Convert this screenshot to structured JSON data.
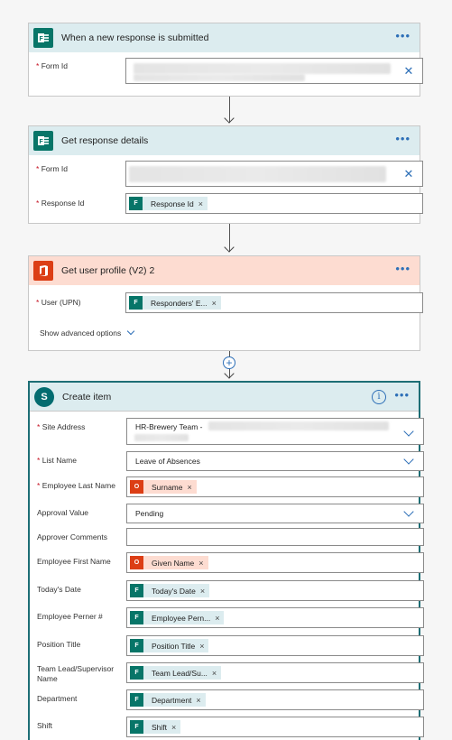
{
  "trigger": {
    "title": "When a new response is submitted",
    "form_id_label": "Form Id",
    "required_mark": "*",
    "more": "•••",
    "clear": "✕"
  },
  "details": {
    "title": "Get response details",
    "form_id_label": "Form Id",
    "response_id_label": "Response Id",
    "response_id_token": "Response Id",
    "more": "•••"
  },
  "profile": {
    "title": "Get user profile (V2) 2",
    "user_label": "User (UPN)",
    "user_token": "Responders' E...",
    "advanced": "Show advanced options",
    "more": "•••"
  },
  "create": {
    "title": "Create item",
    "more": "•••",
    "info": "i",
    "fields": [
      {
        "label": "Site Address",
        "required": true,
        "value": "HR-Brewery Team -"
      },
      {
        "label": "List Name",
        "required": true,
        "value": "Leave of Absences"
      },
      {
        "label": "Employee Last Name",
        "required": true,
        "token": "Surname"
      },
      {
        "label": "Approval Value",
        "required": false,
        "value": "Pending"
      },
      {
        "label": "Approver Comments",
        "required": false
      },
      {
        "label": "Employee First Name",
        "required": false,
        "token": "Given Name"
      },
      {
        "label": "Today's Date",
        "required": false,
        "token": "Today's Date"
      },
      {
        "label": "Employee Perner #",
        "required": false,
        "token": "Employee Pern..."
      },
      {
        "label": "Position Title",
        "required": false,
        "token": "Position Title"
      },
      {
        "label": "Team Lead/Supervisor Name",
        "required": false,
        "token": "Team Lead/Su..."
      },
      {
        "label": "Department",
        "required": false,
        "token": "Department"
      },
      {
        "label": "Shift",
        "required": false,
        "token": "Shift"
      }
    ]
  },
  "token_remove": "×",
  "colors": {
    "forms": "#077568",
    "office": "#dc3e15",
    "sharepoint": "#036c70",
    "accent": "#2d6fb7"
  },
  "icons": {
    "forms": "forms-icon",
    "office": "office-icon",
    "sharepoint": "sharepoint-icon"
  }
}
